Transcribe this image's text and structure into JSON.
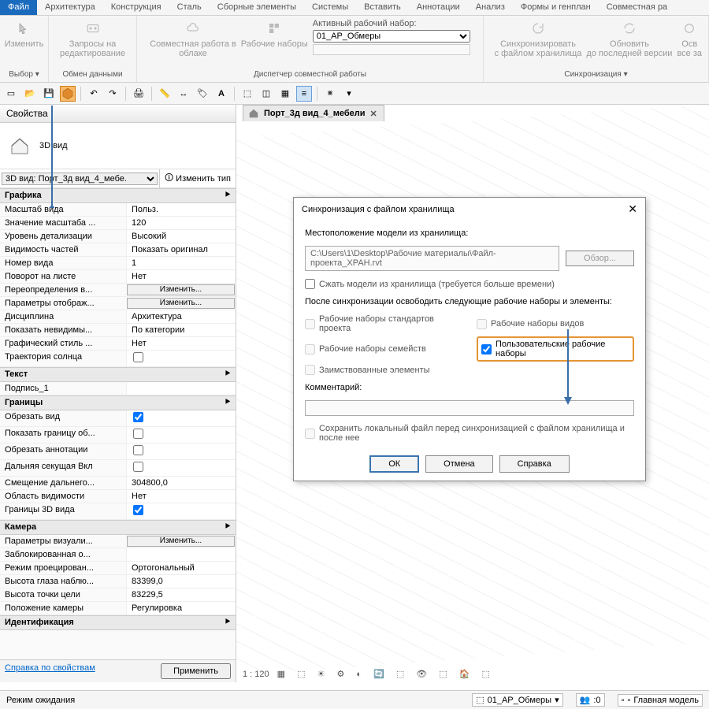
{
  "menu": {
    "items": [
      "Файл",
      "Архитектура",
      "Конструкция",
      "Сталь",
      "Сборные элементы",
      "Системы",
      "Вставить",
      "Аннотации",
      "Анализ",
      "Формы и генплан",
      "Совместная ра"
    ],
    "active": 0
  },
  "ribbon": {
    "g1": {
      "label": "Выбор ▾",
      "item": "Изменить"
    },
    "g2": {
      "label": "Обмен данными",
      "item": "Запросы на\nредактирование"
    },
    "g3": {
      "label": "Диспетчер совместной работы",
      "item1": "Совместная работа в\nоблаке",
      "item2": "Рабочие наборы",
      "ws_label": "Активный рабочий набор:",
      "ws_value": "01_АР_Обмеры"
    },
    "g4": {
      "label": "Синхронизация ▾",
      "item1": "Синхронизировать\nс файлом хранилища",
      "item2": "Обновить\nдо последней версии",
      "item3": "Осв\nвсе за"
    }
  },
  "properties": {
    "title": "Свойства",
    "type": "3D вид",
    "selector": "3D вид: Порт_3д вид_4_мебе.",
    "edit_type": "Изменить тип",
    "groups": [
      {
        "name": "Графика",
        "rows": [
          [
            "Масштаб вида",
            "Польз."
          ],
          [
            "Значение масштаба ...",
            "120"
          ],
          [
            "Уровень детализации",
            "Высокий"
          ],
          [
            "Видимость частей",
            "Показать оригинал"
          ],
          [
            "Номер вида",
            "1"
          ],
          [
            "Поворот на листе",
            "Нет"
          ],
          [
            "Переопределения в...",
            "@btn:Изменить..."
          ],
          [
            "Параметры отображ...",
            "@btn:Изменить..."
          ],
          [
            "Дисциплина",
            "Архитектура"
          ],
          [
            "Показать невидимы...",
            "По категории"
          ],
          [
            "Графический стиль ...",
            "Нет"
          ],
          [
            "Траектория солнца",
            "@chk:0"
          ]
        ]
      },
      {
        "name": "Текст",
        "rows": [
          [
            "Подпись_1",
            ""
          ]
        ]
      },
      {
        "name": "Границы",
        "rows": [
          [
            "Обрезать вид",
            "@chk:1"
          ],
          [
            "Показать границу об...",
            "@chk:0"
          ],
          [
            "Обрезать аннотации",
            "@chk:0"
          ],
          [
            "Дальняя секущая Вкл",
            "@chk:0"
          ],
          [
            "Смещение дальнего...",
            "304800,0"
          ],
          [
            "Область видимости",
            "Нет"
          ],
          [
            "Границы 3D вида",
            "@chk:1"
          ]
        ]
      },
      {
        "name": "Камера",
        "rows": [
          [
            "Параметры визуали...",
            "@btn:Изменить..."
          ],
          [
            "Заблокированная о...",
            ""
          ],
          [
            "Режим проецирован...",
            "Ортогональный"
          ],
          [
            "Высота глаза наблю...",
            "83399,0"
          ],
          [
            "Высота точки цели",
            "83229,5"
          ],
          [
            "Положение камеры",
            "Регулировка"
          ]
        ]
      },
      {
        "name": "Идентификация",
        "rows": []
      }
    ],
    "help": "Справка по свойствам",
    "apply": "Применить"
  },
  "doc": {
    "tab": "Порт_3д вид_4_мебели",
    "scale": "1 : 120"
  },
  "dialog": {
    "title": "Синхронизация с файлом хранилища",
    "loc_label": "Местоположение модели из хранилища:",
    "path": "C:\\Users\\1\\Desktop\\Рабочие материалы\\Файл-проекта_ХРАН.rvt",
    "browse": "Обзор...",
    "compact": "Сжать модели из хранилища (требуется больше времени)",
    "after": "После синхронизации освободить следующие рабочие наборы и элементы:",
    "c1": "Рабочие наборы стандартов проекта",
    "c2": "Рабочие наборы видов",
    "c3": "Рабочие наборы семейств",
    "c4": "Пользовательские рабочие наборы",
    "c5": "Заимствованные элементы",
    "comment_l": "Комментарий:",
    "save_local": "Сохранить локальный файл перед синхронизацией с файлом хранилища и после нее",
    "ok": "ОК",
    "cancel": "Отмена",
    "help": "Справка"
  },
  "status": {
    "mode": "Режим ожидания",
    "ws": "01_АР_Обмеры",
    "zero": ":0",
    "model": "Главная модель"
  }
}
